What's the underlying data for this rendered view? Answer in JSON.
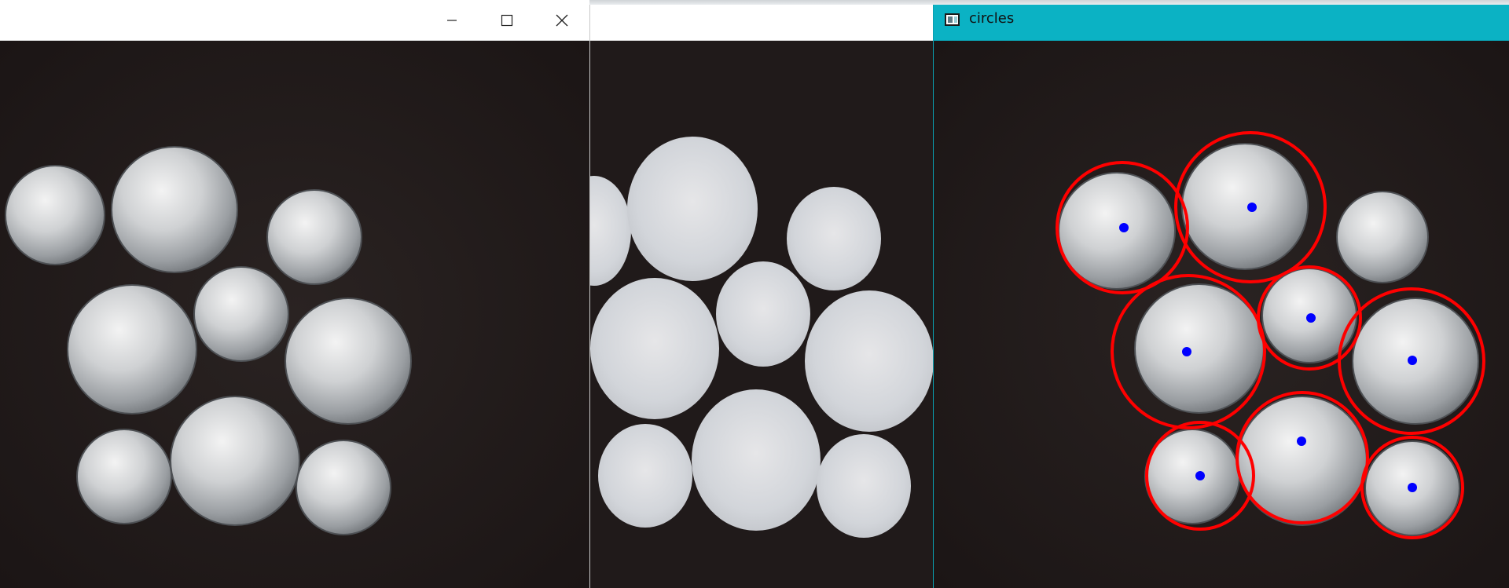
{
  "windows": [
    {
      "id": "original",
      "title": "",
      "controls": {
        "minimize": "minimize-icon",
        "maximize": "maximize-icon",
        "close": "close-icon"
      }
    },
    {
      "id": "filtered",
      "title": ""
    },
    {
      "id": "circles",
      "title": "circles",
      "active": true
    }
  ],
  "colors": {
    "active_titlebar": "#0bb2c4",
    "inactive_titlebar": "#ffffff",
    "background": "#201a1a",
    "circle": "#ff0000",
    "center": "#0000ff"
  }
}
